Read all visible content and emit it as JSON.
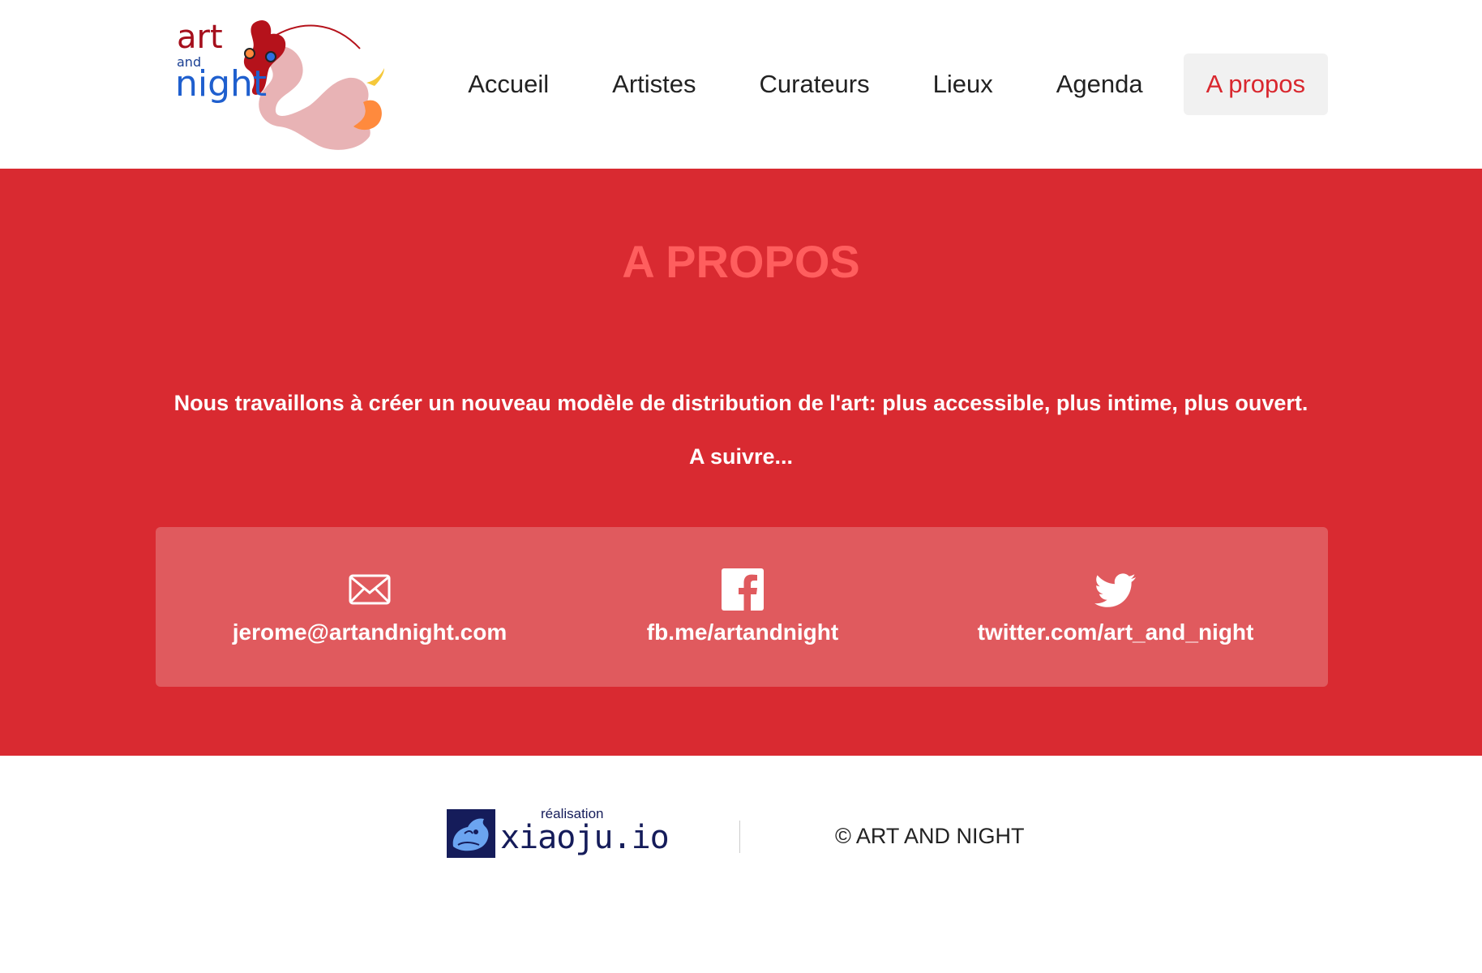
{
  "logo": {
    "art": "art",
    "and": "and",
    "night": "night"
  },
  "nav": {
    "items": [
      {
        "label": "Accueil"
      },
      {
        "label": "Artistes"
      },
      {
        "label": "Curateurs"
      },
      {
        "label": "Lieux"
      },
      {
        "label": "Agenda"
      },
      {
        "label": "A propos",
        "active": true
      }
    ]
  },
  "about": {
    "title": "A PROPOS",
    "text": "Nous travaillons à créer un nouveau modèle de distribution de l'art: plus accessible, plus intime, plus ouvert.",
    "more": "A suivre..."
  },
  "contacts": [
    {
      "icon": "envelope-icon",
      "label": "jerome@artandnight.com"
    },
    {
      "icon": "facebook-icon",
      "label": "fb.me/artandnight"
    },
    {
      "icon": "twitter-icon",
      "label": "twitter.com/art_and_night"
    }
  ],
  "footer": {
    "credit_small": "réalisation",
    "credit_name": "xiaoju.io",
    "copyright": "© ART AND NIGHT"
  },
  "colors": {
    "brand_red": "#d92a31",
    "title_salmon": "#ff5e5e",
    "contact_box": "#e05a5e",
    "active_nav_bg": "#f1f1f1",
    "credit_navy": "#151c5a"
  }
}
